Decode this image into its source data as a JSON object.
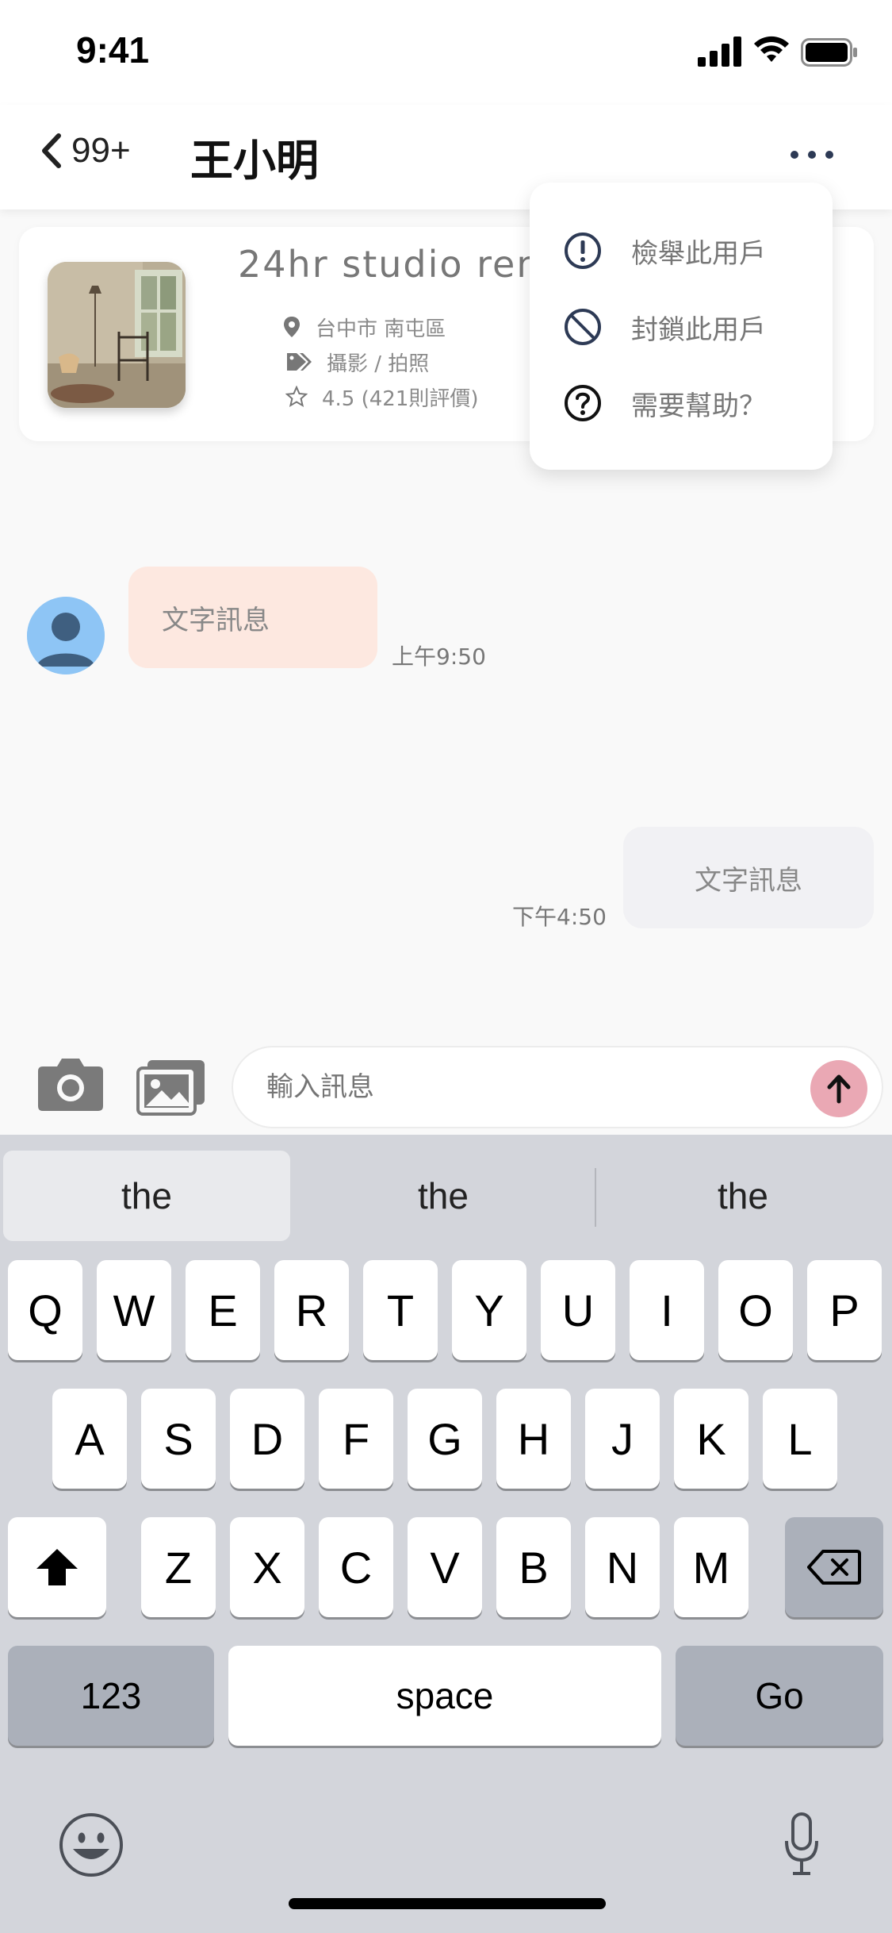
{
  "status_bar": {
    "time": "9:41"
  },
  "nav": {
    "back_count": "99+",
    "title": "王小明"
  },
  "store": {
    "name": "24hr studio rental",
    "location": "台中市 南屯區",
    "category": "攝影 / 拍照",
    "rating": "4.5 (421則評價)"
  },
  "menu": {
    "items": [
      {
        "label": "檢舉此用戶",
        "icon": "exclamation-circle-icon"
      },
      {
        "label": "封鎖此用戶",
        "icon": "block-icon"
      },
      {
        "label": "需要幫助？",
        "icon": "question-circle-icon"
      }
    ]
  },
  "messages": [
    {
      "direction": "incoming",
      "text": "文字訊息",
      "time": "上午9:50"
    },
    {
      "direction": "outgoing",
      "text": "文字訊息",
      "time": "下午4:50"
    }
  ],
  "composer": {
    "placeholder": "輸入訊息"
  },
  "keyboard": {
    "suggestions": [
      "the",
      "the",
      "the"
    ],
    "row1": [
      "Q",
      "W",
      "E",
      "R",
      "T",
      "Y",
      "U",
      "I",
      "O",
      "P"
    ],
    "row2": [
      "A",
      "S",
      "D",
      "F",
      "G",
      "H",
      "J",
      "K",
      "L"
    ],
    "row3": [
      "Z",
      "X",
      "C",
      "V",
      "B",
      "N",
      "M"
    ],
    "numbers_label": "123",
    "space_label": "space",
    "go_label": "Go"
  },
  "colors": {
    "incoming_bubble": "#fde8e0",
    "outgoing_bubble": "#f1f1f4",
    "send_button": "#eaa8b4",
    "keyboard_bg": "#d3d5db"
  }
}
